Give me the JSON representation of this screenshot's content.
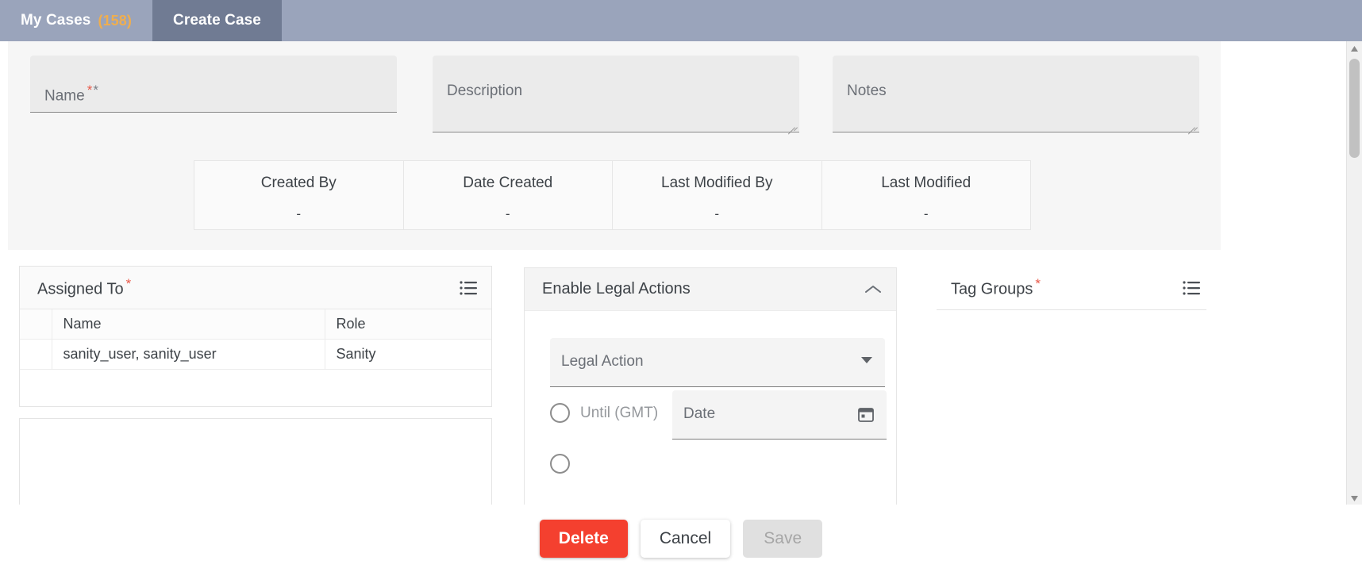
{
  "tabs": [
    {
      "label": "My Cases",
      "count": "(158)",
      "active": false
    },
    {
      "label": "Create Case",
      "count": "",
      "active": true
    }
  ],
  "form": {
    "name": {
      "label": "Name",
      "value": "",
      "required_marker": "*",
      "secondary_marker": "*"
    },
    "description": {
      "label": "Description",
      "value": ""
    },
    "notes": {
      "label": "Notes",
      "value": ""
    }
  },
  "metadata": {
    "headers": [
      "Created By",
      "Date Created",
      "Last Modified By",
      "Last Modified"
    ],
    "values": [
      "-",
      "-",
      "-",
      "-"
    ]
  },
  "assigned_to": {
    "title": "Assigned To",
    "required_marker": "*",
    "icon": "list-icon",
    "columns": [
      "",
      "Name",
      "Role"
    ],
    "rows": [
      {
        "check": "",
        "name": "sanity_user, sanity_user",
        "role": "Sanity"
      }
    ]
  },
  "legal_actions": {
    "title": "Enable Legal Actions",
    "collapse_icon": "chevron-up-icon",
    "select": {
      "label": "Legal Action",
      "value": "",
      "icon": "chevron-down-icon"
    },
    "radios": [
      {
        "label": "Until (GMT)",
        "selected": false
      },
      {
        "label": "",
        "selected": false
      }
    ],
    "date": {
      "label": "Date",
      "value": "",
      "icon": "calendar-icon"
    }
  },
  "tag_groups": {
    "title": "Tag Groups",
    "required_marker": "*",
    "icon": "list-icon"
  },
  "footer": {
    "delete_label": "Delete",
    "cancel_label": "Cancel",
    "save_label": "Save"
  },
  "colors": {
    "tab_bar": "#9aa4bb",
    "tab_active": "#707b93",
    "tab_count": "#f0ae4e",
    "required": "#e8594a",
    "delete_button": "#f4402f",
    "save_disabled_bg": "#e0e0e0"
  }
}
